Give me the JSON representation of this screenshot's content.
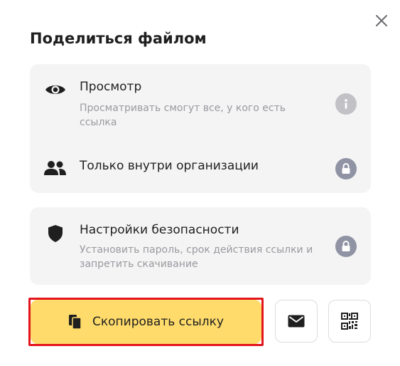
{
  "dialog": {
    "title": "Поделиться файлом",
    "close_icon": "close-icon"
  },
  "access": {
    "view": {
      "icon": "eye-icon",
      "title": "Просмотр",
      "subtitle": "Просматривать смогут все, у кого есть ссылка",
      "badge_icon": "info-icon"
    },
    "org_only": {
      "icon": "people-icon",
      "title": "Только внутри организации",
      "badge_icon": "lock-icon"
    }
  },
  "security": {
    "icon": "shield-icon",
    "title": "Настройки безопасности",
    "subtitle": "Установить пароль, срок действия ссылки и запретить скачивание",
    "badge_icon": "lock-icon"
  },
  "actions": {
    "copy_label": "Скопировать ссылку",
    "copy_icon": "copy-icon",
    "mail_icon": "mail-icon",
    "qr_icon": "qr-code-icon"
  },
  "colors": {
    "primary_button": "#fedb6a",
    "highlight": "#e3141b",
    "card_bg": "#f4f4f5",
    "muted_text": "#9a9a9f",
    "lock_badge": "#8f93a3",
    "info_badge": "#c2c2c6"
  }
}
